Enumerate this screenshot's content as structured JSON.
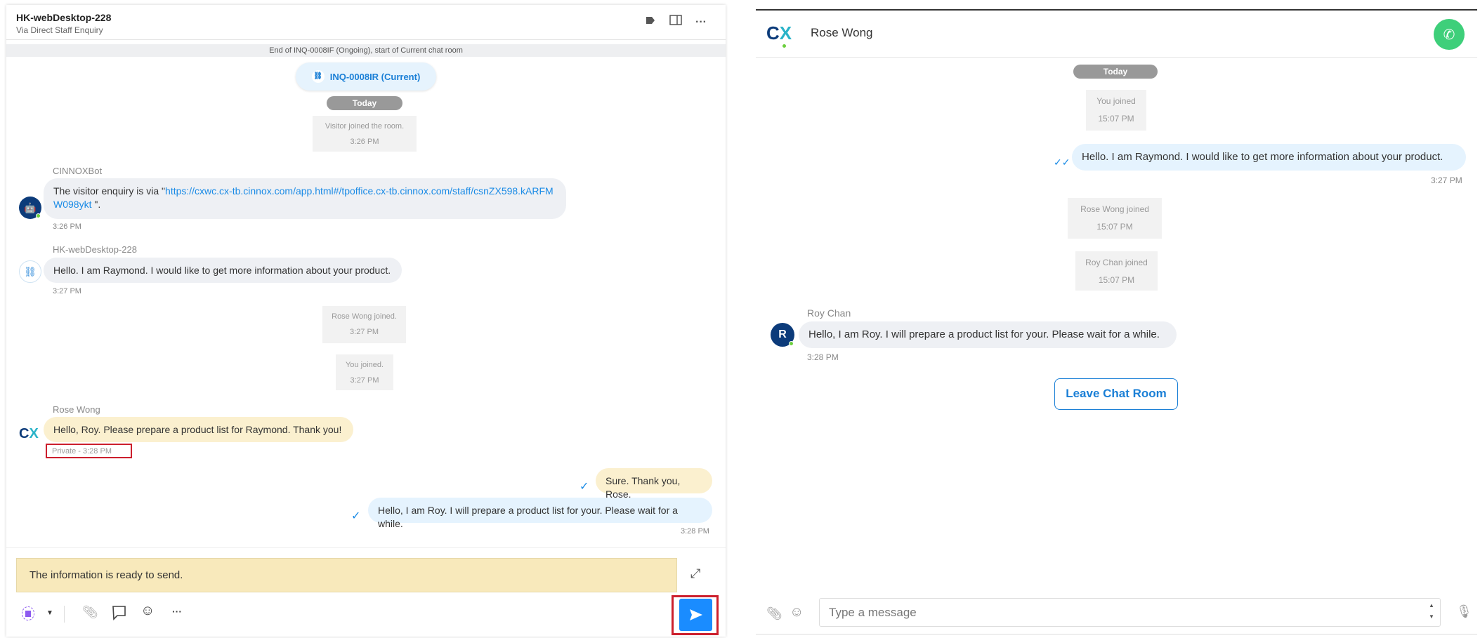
{
  "left": {
    "header": {
      "title": "HK-webDesktop-228",
      "subtitle": "Via Direct Staff Enquiry",
      "icons": [
        "tag-icon",
        "split-panel-icon",
        "more-icon"
      ]
    },
    "banner": "End of INQ-0008IF (Ongoing), start of Current chat room",
    "inquiry_pill": "INQ-0008IR (Current)",
    "today": "Today",
    "system": [
      {
        "text": "Visitor joined the room.",
        "time": "3:26 PM"
      },
      {
        "text": "Rose Wong joined.",
        "time": "3:27 PM"
      },
      {
        "text": "You joined.",
        "time": "3:27 PM"
      }
    ],
    "bot": {
      "name": "CINNOXBot",
      "text_pre": "The visitor enquiry is via \"",
      "link": "https://cxwc.cx-tb.cinnox.com/app.html#/tpoffice.cx-tb.cinnox.com/staff/csnZX598.kARFMW098ykt",
      "text_post": " \".",
      "time": "3:26 PM"
    },
    "visitor": {
      "name": "HK-webDesktop-228",
      "text": "Hello. I am Raymond. I would like to get more information about your product.",
      "time": "3:27 PM"
    },
    "rose": {
      "name": "Rose Wong",
      "text": "Hello, Roy. Please prepare a product list for Raymond. Thank you!",
      "time": "Private - 3:28 PM"
    },
    "out1": {
      "text": "Sure. Thank you, Rose."
    },
    "out2": {
      "text": "Hello, I am Roy. I will prepare a product list for your. Please wait for a while.",
      "time": "3:28 PM"
    },
    "composer": {
      "value": "The information is ready to send.",
      "highlight_color": "#cc1f2d",
      "send_color": "#1a8cff"
    }
  },
  "right": {
    "header": {
      "name": "Rose Wong",
      "call_color": "#3ecf7a"
    },
    "today": "Today",
    "system": [
      {
        "text": "You joined",
        "time": "15:07 PM"
      },
      {
        "text": "Rose Wong joined",
        "time": "15:07 PM"
      },
      {
        "text": "Roy Chan joined",
        "time": "15:07 PM"
      }
    ],
    "out": {
      "text": "Hello. I am Raymond. I would like to get more information about your product.",
      "time": "3:27 PM"
    },
    "roy": {
      "name": "Roy Chan",
      "initial": "R",
      "text": "Hello, I am Roy. I will prepare a product list for your. Please wait for a while.",
      "time": "3:28 PM"
    },
    "leave_button": "Leave Chat Room",
    "input_placeholder": "Type a message"
  }
}
